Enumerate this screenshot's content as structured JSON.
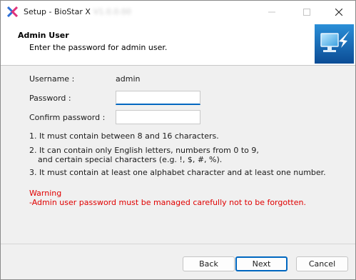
{
  "window": {
    "title": "Setup - BioStar X",
    "version_redacted": "V1.0.0.00",
    "controls": {
      "minimize": "minimize-icon",
      "maximize": "maximize-icon",
      "close": "close-icon"
    }
  },
  "header": {
    "title": "Admin User",
    "subtitle": "Enter the password for admin user."
  },
  "form": {
    "username_label": "Username :",
    "username_value": "admin",
    "password_label": "Password :",
    "password_value": "",
    "confirm_label": "Confirm password :",
    "confirm_value": ""
  },
  "rules": [
    "1. It must contain between 8 and 16 characters.",
    "2. It can contain only English letters, numbers from 0 to 9,",
    "and certain special characters (e.g. !, $, #, %).",
    "3. It must contain at least one alphabet character and at least one number."
  ],
  "warning": {
    "title": "Warning",
    "text": "-Admin user password must be managed carefully not to be forgotten."
  },
  "buttons": {
    "back": "Back",
    "next": "Next",
    "cancel": "Cancel"
  },
  "colors": {
    "accent": "#0067c0",
    "warning": "#e00000",
    "dialog_bg": "#f0f0f0"
  }
}
